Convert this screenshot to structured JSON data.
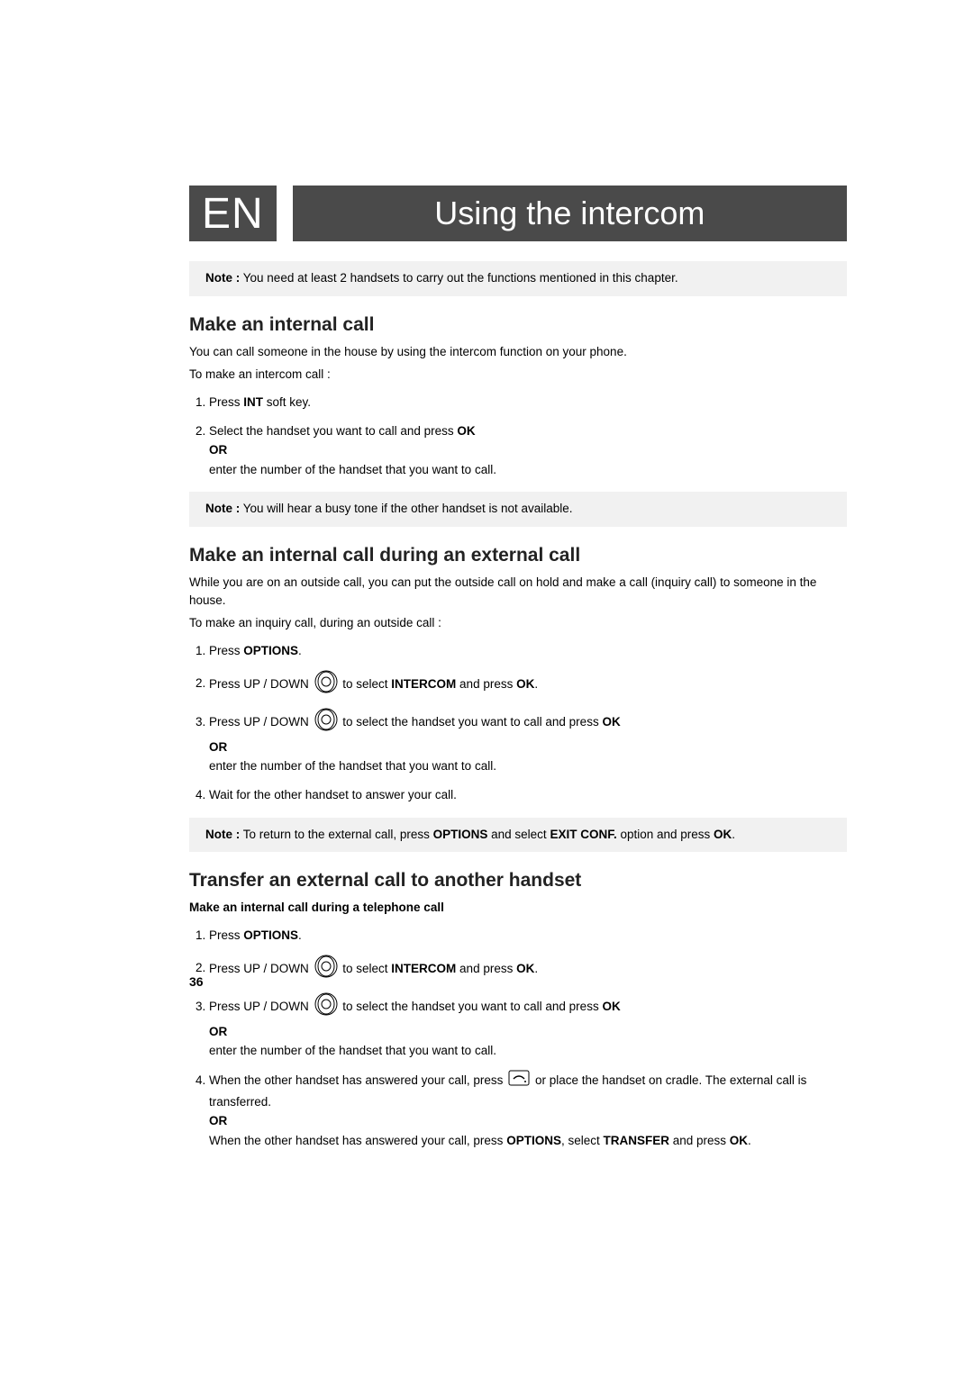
{
  "header": {
    "language": "EN",
    "title": "Using the intercom"
  },
  "note1": {
    "label": "Note :",
    "text": "You need at least 2 handsets to carry out the functions mentioned in this chapter."
  },
  "s1": {
    "heading": "Make an internal call",
    "p1": "You can call someone in the house by using the intercom function on your phone.",
    "p2": "To make an intercom call :",
    "step1_a": "Press ",
    "step1_int": "INT",
    "step1_b": " soft key.",
    "step2_a": "Select the handset you want to call and press ",
    "step2_ok": "OK",
    "step2_or": "OR",
    "step2_b": "enter the number of the handset that you want to call."
  },
  "note2": {
    "label": "Note :",
    "text": "You will hear a busy tone if the other handset is not available."
  },
  "s2": {
    "heading": "Make an internal call during an external call",
    "p1": "While you are on an outside call, you can put the outside call on hold and make a call (inquiry call) to someone in the house.",
    "p2": "To make an inquiry call, during an outside call :",
    "step1_a": "Press ",
    "step1_opt": "OPTIONS",
    "step1_b": ".",
    "step2_a": "Press UP / DOWN ",
    "step2_b": " to select ",
    "step2_intercom": "INTERCOM",
    "step2_c": " and press ",
    "step2_ok": "OK",
    "step2_d": ".",
    "step3_a": "Press UP / DOWN ",
    "step3_b": " to select the handset you want to call and press ",
    "step3_ok": "OK",
    "step3_or": "OR",
    "step3_c": "enter the number of the handset that you want to call.",
    "step4": "Wait for the other handset to answer your call."
  },
  "note3": {
    "label": "Note :",
    "a": "To return to the external call, press ",
    "opt": "OPTIONS",
    "b": " and select ",
    "exit": "EXIT CONF.",
    "c": " option and press ",
    "ok": "OK",
    "d": "."
  },
  "s3": {
    "heading": "Transfer an external call to another handset",
    "sub": "Make an internal call during a telephone call",
    "step1_a": "Press ",
    "step1_opt": "OPTIONS",
    "step1_b": ".",
    "step2_a": "Press UP / DOWN ",
    "step2_b": " to select ",
    "step2_intercom": "INTERCOM",
    "step2_c": " and press ",
    "step2_ok": "OK",
    "step2_d": ".",
    "step3_a": "Press UP / DOWN ",
    "step3_b": " to select the handset you want to call and press ",
    "step3_ok": "OK",
    "step3_or": "OR",
    "step3_c": "enter the number of the handset that you want to call.",
    "step4_a": "When the other handset has answered your call, press ",
    "step4_b": " or place the handset on cradle. The external call is transferred.",
    "step4_or": "OR",
    "step4_c": "When the other handset has answered your call, press ",
    "step4_opt": "OPTIONS",
    "step4_d": ", select ",
    "step4_tr": "TRANSFER",
    "step4_e": " and press ",
    "step4_ok": "OK",
    "step4_f": "."
  },
  "page_number": "36"
}
